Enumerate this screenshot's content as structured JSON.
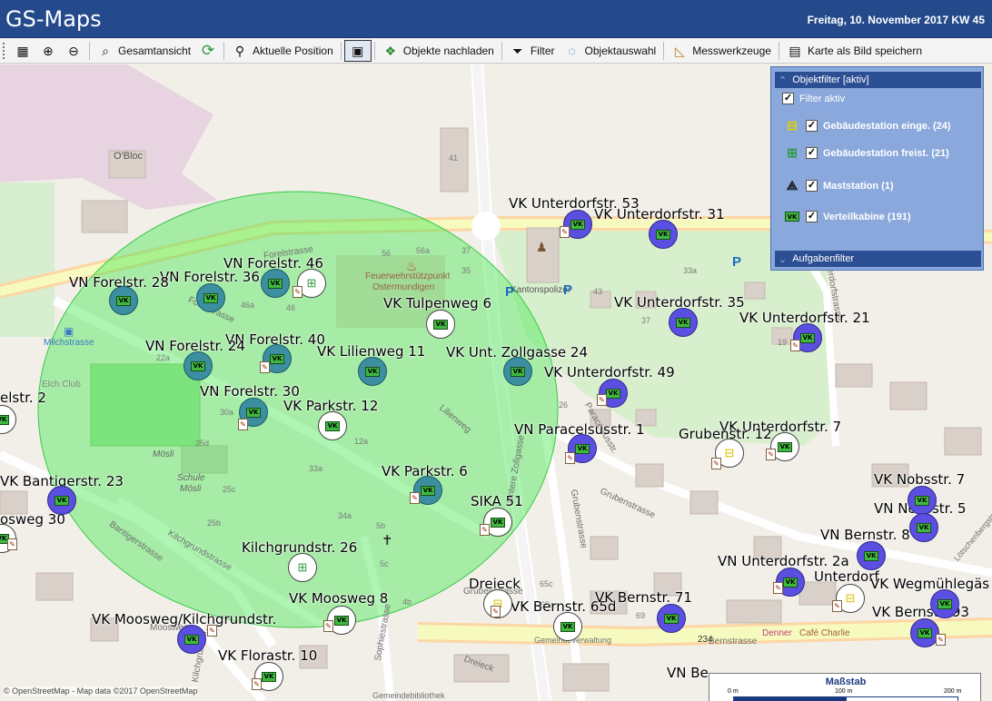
{
  "app": {
    "title": "GS-Maps",
    "date": "Freitag, 10. November 2017  KW 45"
  },
  "toolbar": {
    "gesamtansicht": "Gesamtansicht",
    "aktuelle_position": "Aktuelle Position",
    "objekte_nachladen": "Objekte nachladen",
    "filter": "Filter",
    "objektauswahl": "Objektauswahl",
    "messwerkzeuge": "Messwerkzeuge",
    "karte_speichern": "Karte als Bild speichern"
  },
  "filter_panel": {
    "header": "Objektfilter [aktiv]",
    "filter_aktiv": "Filter aktiv",
    "items": [
      {
        "label": "Gebäudestation einge. (24)",
        "checked": true,
        "icon": "gebaeudestation-eingebaut-icon"
      },
      {
        "label": "Gebäudestation freist. (21)",
        "checked": true,
        "icon": "gebaeudestation-freistehend-icon"
      },
      {
        "label": "Maststation (1)",
        "checked": true,
        "icon": "maststation-icon"
      },
      {
        "label": "Verteilkabine (191)",
        "checked": true,
        "icon": "verteilkabine-icon"
      }
    ],
    "aufgabenfilter": "Aufgabenfilter"
  },
  "map": {
    "marker_text": "VK",
    "labels": [
      "VK Unterdorfstr. 53",
      "VK Unterdorfstr. 31",
      "VN Forelstr. 46",
      "VN Forelstr. 36",
      "VN Forelstr. 28",
      "VK Tulpenweg 6",
      "VK Unterdorfstr. 35",
      "VK Unterdorfstr. 21",
      "VN Forelstr. 40",
      "VN Forelstr. 24",
      "VK Lilienweg 11",
      "VK Unt. Zollgasse 24",
      "VK Unterdorfstr. 49",
      "VN Forelstr. 30",
      "VK Parkstr. 12",
      "VN Paracelsusstr. 1",
      "VK Unterdorfstr. 7",
      "Grubenstr. 12",
      "VK Bantigerstr. 23",
      "VK Parkstr. 6",
      "SIKA 51",
      "VK Nobsstr. 7",
      "VN Nobsstr. 5",
      "VN Bernstr. 8",
      "Kilchgrundstr. 26",
      "VN Unterdorfstr. 2a",
      "Unterdorf",
      "VK Wegmühlegäs",
      "Dreieck",
      "VK Bernstr. 65d",
      "VK Bernstr. 71",
      "VK Moosweg 8",
      "VK Bernstr. 93",
      "VK Moosweg/Kilchgrundstr.",
      "VK Florastr. 10",
      "VN Be",
      "elstr. 2",
      "osweg 30"
    ],
    "places": [
      "O'Bloc",
      "Feuerwehrstützpunkt",
      "Ostermundigen",
      "Kantonspolizei",
      "Milchstrasse",
      "Elch Club",
      "Mösli",
      "Schule",
      "Mösli",
      "Gemeindeverwaltung",
      "Gemeindebibliothek",
      "Denner",
      "Café Charlie",
      "Forelstrasse",
      "Forelstrasse",
      "Lilienweg",
      "Untere Zollgasse",
      "Grubenstrasse",
      "Grubenstrasse",
      "Bantigerstrasse",
      "Kilchgrundstrasse",
      "Sophiestrasse",
      "Dreieck",
      "Bernstrasse",
      "Moosweg",
      "Paracelsusstr.",
      "Unterdorfstrasse",
      "Kilchgrundstr.",
      "Grubenstrasse",
      "Lötschenbergstr."
    ],
    "house_numbers": [
      "41",
      "56",
      "56a",
      "37",
      "35",
      "43",
      "46a",
      "46",
      "22a",
      "30a",
      "12a",
      "25d",
      "25c",
      "25b",
      "33a",
      "34a",
      "5b",
      "5c",
      "4b",
      "65c",
      "65e",
      "234",
      "69",
      "26",
      "37",
      "33a",
      "19"
    ]
  },
  "scalebar": {
    "title": "Maßstab",
    "ticks": [
      "0 m",
      "100 m",
      "200 m"
    ]
  },
  "attribution": "© OpenStreetMap - Map data ©2017 OpenStreetMap"
}
